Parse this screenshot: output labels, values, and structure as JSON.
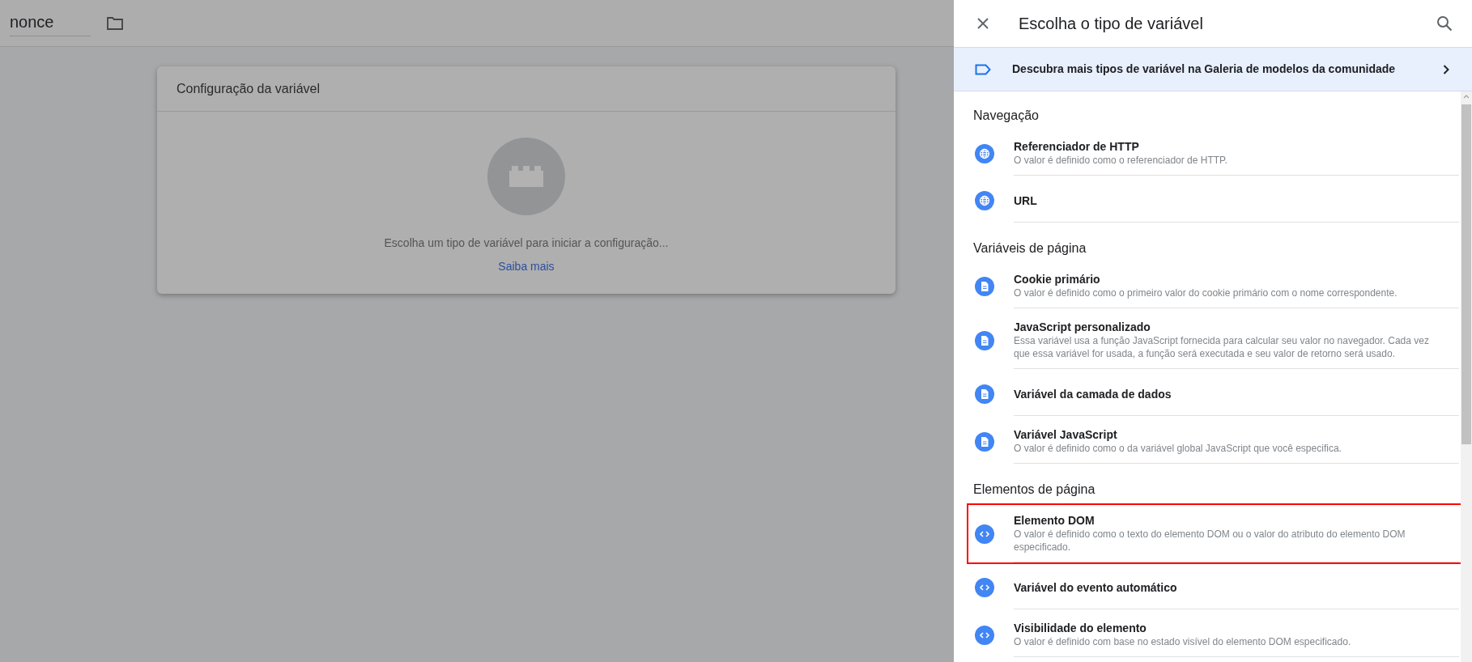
{
  "page": {
    "name_field": {
      "value": "nonce"
    },
    "card": {
      "title": "Configuração da variável",
      "prompt": "Escolha um tipo de variável para iniciar a configuração...",
      "link": "Saiba mais"
    }
  },
  "panel": {
    "title": "Escolha o tipo de variável",
    "banner": {
      "text": "Descubra mais tipos de variável na Galeria de modelos da comunidade"
    },
    "sections": [
      {
        "heading": "Navegação",
        "items": [
          {
            "kind": "globe",
            "title": "Referenciador de HTTP",
            "description": "O valor é definido como o referenciador de HTTP.",
            "highlighted": false
          },
          {
            "kind": "globe",
            "title": "URL",
            "highlighted": false
          }
        ]
      },
      {
        "heading": "Variáveis de página",
        "items": [
          {
            "kind": "document",
            "title": "Cookie primário",
            "description": "O valor é definido como o primeiro valor do cookie primário com o nome correspondente.",
            "highlighted": false
          },
          {
            "kind": "document",
            "title": "JavaScript personalizado",
            "description": "Essa variável usa a função JavaScript fornecida para calcular seu valor no navegador. Cada vez que essa variável for usada, a função será executada e seu valor de retorno será usado.",
            "highlighted": false
          },
          {
            "kind": "document",
            "title": "Variável da camada de dados",
            "highlighted": false
          },
          {
            "kind": "document",
            "title": "Variável JavaScript",
            "description": "O valor é definido como o da variável global JavaScript que você especifica.",
            "highlighted": false
          }
        ]
      },
      {
        "heading": "Elementos de página",
        "items": [
          {
            "kind": "code",
            "title": "Elemento DOM",
            "description": "O valor é definido como o texto do elemento DOM ou o valor do atributo do elemento DOM especificado.",
            "highlighted": true
          },
          {
            "kind": "code",
            "title": "Variável do evento automático",
            "highlighted": false
          },
          {
            "kind": "code",
            "title": "Visibilidade do elemento",
            "description": "O valor é definido com base no estado visível do elemento DOM especificado.",
            "highlighted": false
          }
        ]
      }
    ]
  }
}
